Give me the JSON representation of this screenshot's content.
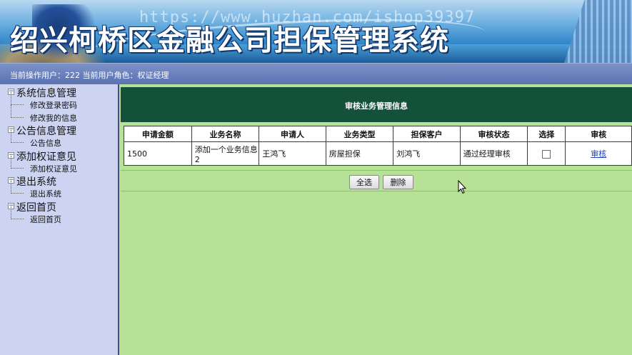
{
  "banner": {
    "watermark_url": "https://www.huzhan.com/ishop39397",
    "title": "绍兴柯桥区金融公司担保管理系统"
  },
  "status": {
    "text": "当前操作用户：222 当前用户角色：权证经理"
  },
  "sidebar": {
    "groups": [
      {
        "label": "系统信息管理",
        "items": [
          "修改登录密码",
          "修改我的信息"
        ]
      },
      {
        "label": "公告信息管理",
        "items": [
          "公告信息"
        ]
      },
      {
        "label": "添加权证意见",
        "items": [
          "添加权证意见"
        ]
      },
      {
        "label": "退出系统",
        "items": [
          "退出系统"
        ]
      },
      {
        "label": "返回首页",
        "items": [
          "返回首页"
        ]
      }
    ]
  },
  "main": {
    "panel_title": "审核业务管理信息",
    "columns": [
      "申请金额",
      "业务名称",
      "申请人",
      "业务类型",
      "担保客户",
      "审核状态",
      "选择",
      "审核"
    ],
    "rows": [
      {
        "amount": "1500",
        "name": "添加一个业务信息2",
        "applicant": "王鸿飞",
        "type": "房屋担保",
        "client": "刘鸿飞",
        "status": "通过经理审核",
        "selected": false,
        "action": "审核"
      }
    ],
    "buttons": {
      "select_all": "全选",
      "delete": "删除"
    }
  }
}
